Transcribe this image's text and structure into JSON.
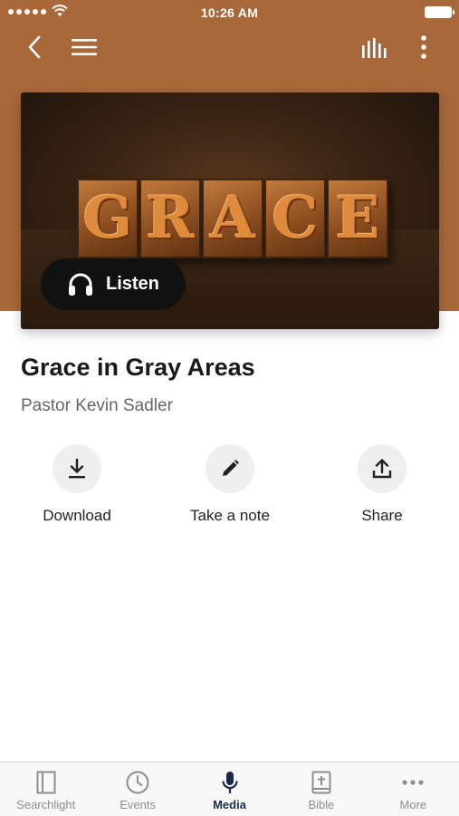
{
  "status_bar": {
    "time": "10:26 AM"
  },
  "nav": {
    "icons": {
      "back": "chevron-left-icon",
      "menu": "hamburger-icon",
      "audio": "equalizer-icon",
      "more": "vertical-dots-icon"
    }
  },
  "artwork": {
    "letters": [
      "G",
      "R",
      "A",
      "C",
      "E"
    ],
    "listen_label": "Listen"
  },
  "sermon": {
    "title": "Grace in Gray Areas",
    "speaker": "Pastor Kevin Sadler"
  },
  "actions": {
    "download": "Download",
    "take_note": "Take a note",
    "share": "Share"
  },
  "tabs": [
    {
      "label": "Searchlight",
      "icon": "book-icon",
      "active": false
    },
    {
      "label": "Events",
      "icon": "clock-icon",
      "active": false
    },
    {
      "label": "Media",
      "icon": "microphone-icon",
      "active": true
    },
    {
      "label": "Bible",
      "icon": "bible-icon",
      "active": false
    },
    {
      "label": "More",
      "icon": "horizontal-dots-icon",
      "active": false
    }
  ],
  "colors": {
    "header": "#a8683a",
    "active_tab": "#1b2a4a",
    "inactive_tab": "#8e8e8e"
  }
}
